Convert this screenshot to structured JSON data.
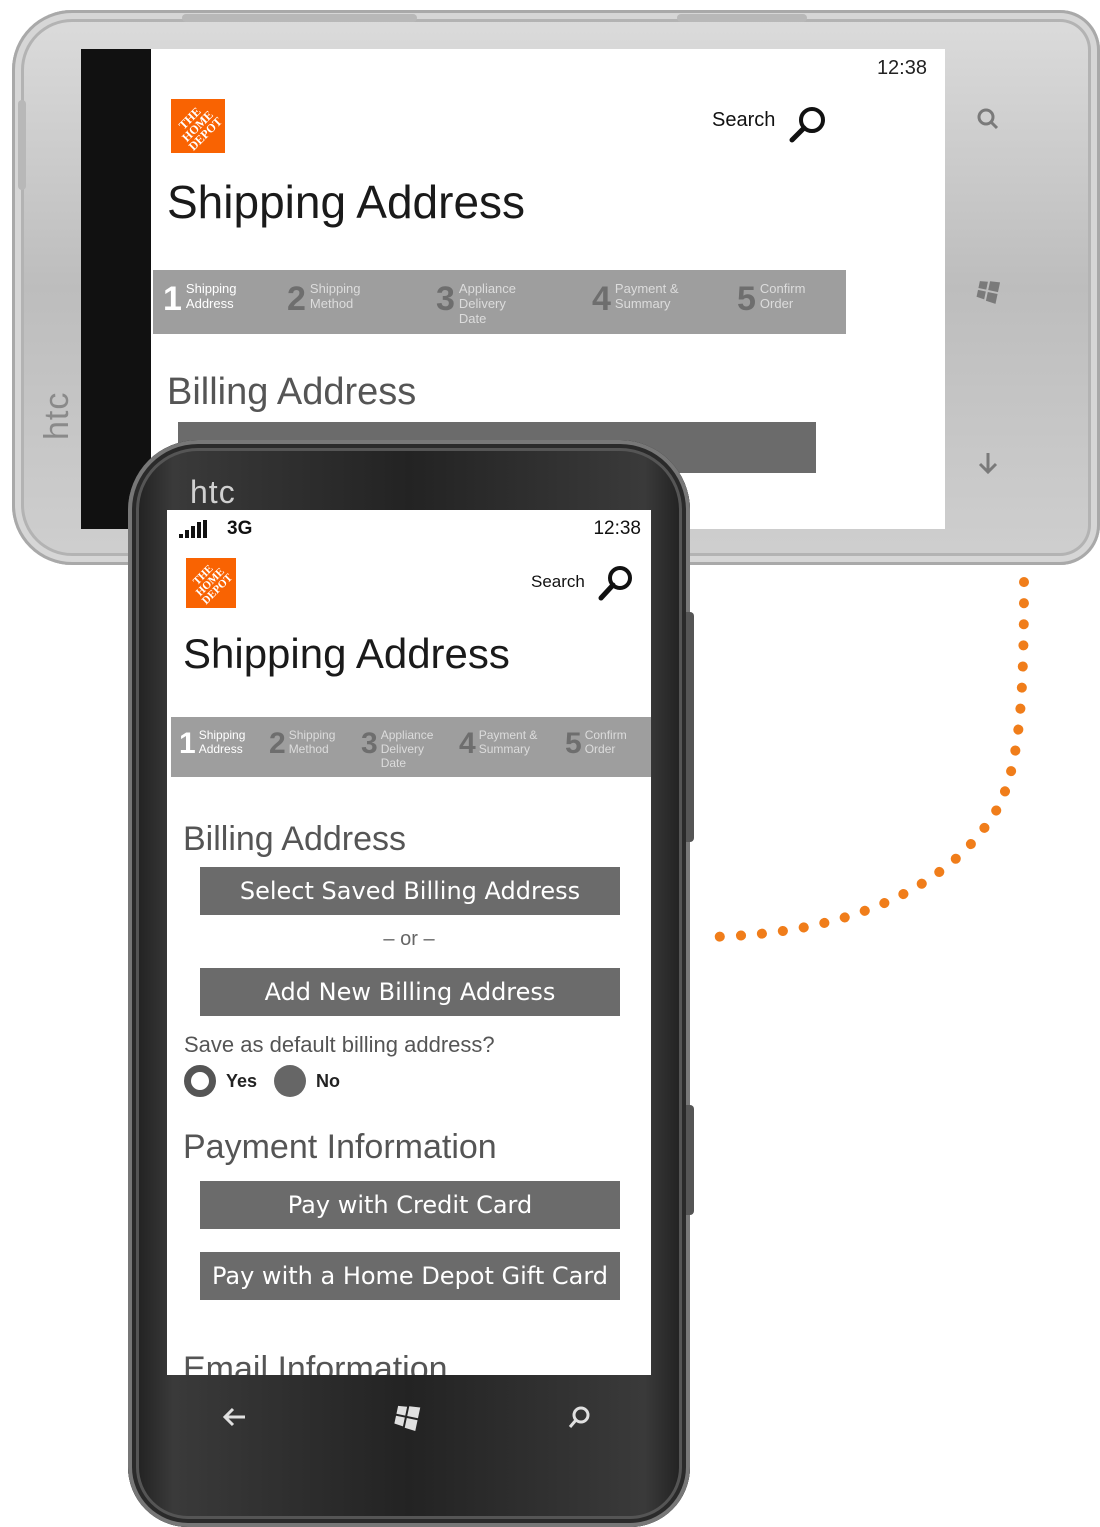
{
  "colors": {
    "brand_orange": "#f96302",
    "button_gray": "#6b6b6b",
    "step_bar": "#9e9e9e",
    "connector": "#f07d1a"
  },
  "landscape": {
    "device_brand": "htc",
    "status_time": "12:38",
    "search_label": "Search",
    "page_title": "Shipping Address",
    "steps": [
      {
        "num": "1",
        "label": "Shipping Address",
        "active": true
      },
      {
        "num": "2",
        "label": "Shipping Method"
      },
      {
        "num": "3",
        "label": "Appliance Delivery Date"
      },
      {
        "num": "4",
        "label": "Payment & Summary"
      },
      {
        "num": "5",
        "label": "Confirm Order"
      }
    ],
    "section_title": "Billing Address",
    "hw_buttons": [
      "search-icon",
      "windows-icon",
      "back-icon"
    ]
  },
  "portrait": {
    "device_brand": "htc",
    "network": "3G",
    "status_time": "12:38",
    "search_label": "Search",
    "page_title": "Shipping Address",
    "steps": [
      {
        "num": "1",
        "label": "Shipping Address",
        "active": true
      },
      {
        "num": "2",
        "label": "Shipping Method"
      },
      {
        "num": "3",
        "label": "Appliance Delivery Date"
      },
      {
        "num": "4",
        "label": "Payment & Summary"
      },
      {
        "num": "5",
        "label": "Confirm Order"
      }
    ],
    "billing_title": "Billing Address",
    "select_saved_label": "Select Saved Billing Address",
    "or_text": "– or –",
    "add_new_label": "Add New Billing Address",
    "default_question": "Save as default billing address?",
    "radio_yes": "Yes",
    "radio_no": "No",
    "radio_selected": "No",
    "payment_title": "Payment Information",
    "pay_credit_label": "Pay with Credit Card",
    "pay_gift_label": "Pay with a Home Depot Gift Card",
    "email_title": "Email Information",
    "hw_buttons": [
      "back-icon",
      "windows-icon",
      "search-icon"
    ]
  }
}
